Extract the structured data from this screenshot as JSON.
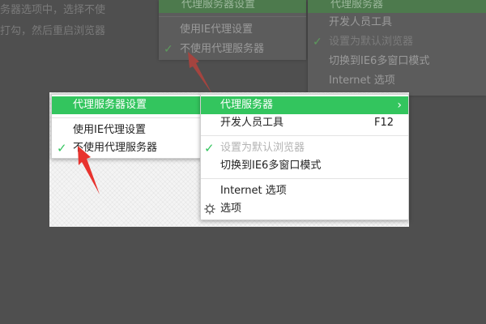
{
  "background": {
    "line1": "务器选项中，选择不使",
    "line2": "打勾，然后重启浏览器",
    "menu_a": {
      "header": "代理服务器设置",
      "items": [
        {
          "label": "使用IE代理设置",
          "checked": false
        },
        {
          "label": "不使用代理服务器",
          "checked": true
        }
      ]
    },
    "menu_b": {
      "header": "代理服务器",
      "items": [
        {
          "label": "开发人员工具",
          "checked": false,
          "disabled": false
        },
        {
          "label": "设置为默认浏览器",
          "checked": true,
          "disabled": true
        },
        {
          "label": "切换到IE6多窗口模式",
          "checked": false,
          "disabled": false
        },
        {
          "label": "Internet 选项",
          "checked": false,
          "disabled": false
        }
      ]
    }
  },
  "submenu": {
    "header": "代理服务器设置",
    "items": [
      {
        "label": "使用IE代理设置",
        "checked": false
      },
      {
        "label": "不使用代理服务器",
        "checked": true
      }
    ]
  },
  "context_menu": {
    "highlight": {
      "label": "代理服务器",
      "chevron": "›"
    },
    "dev_tools": {
      "label": "开发人员工具",
      "shortcut": "F12"
    },
    "set_default": {
      "label": "设置为默认浏览器",
      "checked": true,
      "disabled": true
    },
    "ie6_mode": {
      "label": "切换到IE6多窗口模式"
    },
    "internet_options": {
      "label": "Internet 选项"
    },
    "options": {
      "label": "选项",
      "icon": "gear-icon"
    }
  },
  "colors": {
    "accent_green": "#33c55e",
    "arrow_red": "#e8332e",
    "page_background": "#4f4f4f"
  }
}
